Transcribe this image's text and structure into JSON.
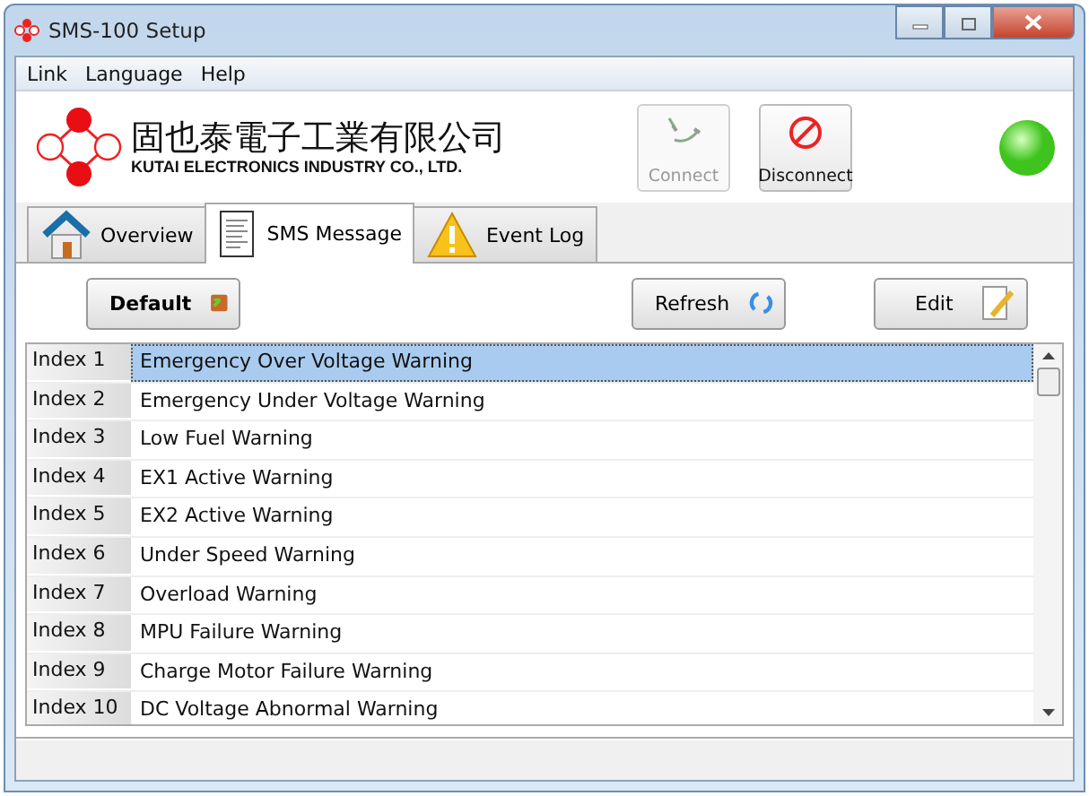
{
  "window": {
    "title": "SMS-100 Setup"
  },
  "menu": [
    "Link",
    "Language",
    "Help"
  ],
  "header": {
    "company_name": "固也泰電子工業有限公司",
    "company_name_en": "KUTAI ELECTRONICS INDUSTRY CO., LTD.",
    "buttons": [
      {
        "label": "Connect",
        "kind": "connect",
        "disabled": true
      },
      {
        "label": "Disconnect",
        "kind": "disconnect",
        "disabled": false
      }
    ],
    "status_light": {
      "color": "#3ec41c"
    }
  },
  "tabs": [
    {
      "label": "Overview",
      "kind": "house",
      "selected": false
    },
    {
      "label": "SMS Message",
      "kind": "document",
      "selected": true
    },
    {
      "label": "Event Log",
      "kind": "warning",
      "selected": false
    }
  ],
  "toolbar": [
    {
      "label": "Default",
      "kind": "default"
    },
    {
      "label": "Refresh",
      "kind": "refresh"
    },
    {
      "label": "Edit",
      "kind": "edit"
    }
  ],
  "table": {
    "rows": [
      {
        "index": "Index 1",
        "message": "Emergency Over Voltage Warning",
        "selected": true
      },
      {
        "index": "Index 2",
        "message": "Emergency Under Voltage Warning",
        "selected": false
      },
      {
        "index": "Index 3",
        "message": "Low Fuel Warning",
        "selected": false
      },
      {
        "index": "Index 4",
        "message": "EX1 Active Warning",
        "selected": false
      },
      {
        "index": "Index 5",
        "message": "EX2 Active Warning",
        "selected": false
      },
      {
        "index": "Index 6",
        "message": "Under Speed Warning",
        "selected": false
      },
      {
        "index": "Index 7",
        "message": "Overload Warning",
        "selected": false
      },
      {
        "index": "Index 8",
        "message": "MPU Failure Warning",
        "selected": false
      },
      {
        "index": "Index 9",
        "message": "Charge Motor Failure Warning",
        "selected": false
      },
      {
        "index": "Index 10",
        "message": "DC Voltage Abnormal Warning",
        "selected": false
      }
    ]
  }
}
